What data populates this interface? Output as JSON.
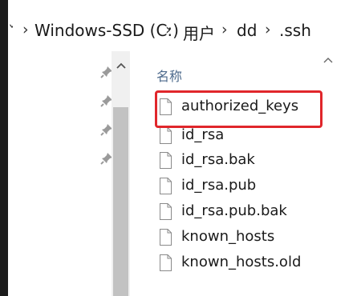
{
  "breadcrumb": {
    "items": [
      "Windows-SSD (C:)",
      "用户",
      "dd",
      ".ssh"
    ]
  },
  "file_list": {
    "column_header": "名称",
    "files": [
      "authorized_keys",
      "id_rsa",
      "id_rsa.bak",
      "id_rsa.pub",
      "id_rsa.pub.bak",
      "known_hosts",
      "known_hosts.old"
    ]
  },
  "colors": {
    "highlight": "#e0262b",
    "header_text": "#4d6a8c"
  },
  "icons": {
    "pin": "pin-icon",
    "file": "file-icon",
    "scroll_up": "chevron-up-icon",
    "sort": "chevron-up-icon"
  }
}
